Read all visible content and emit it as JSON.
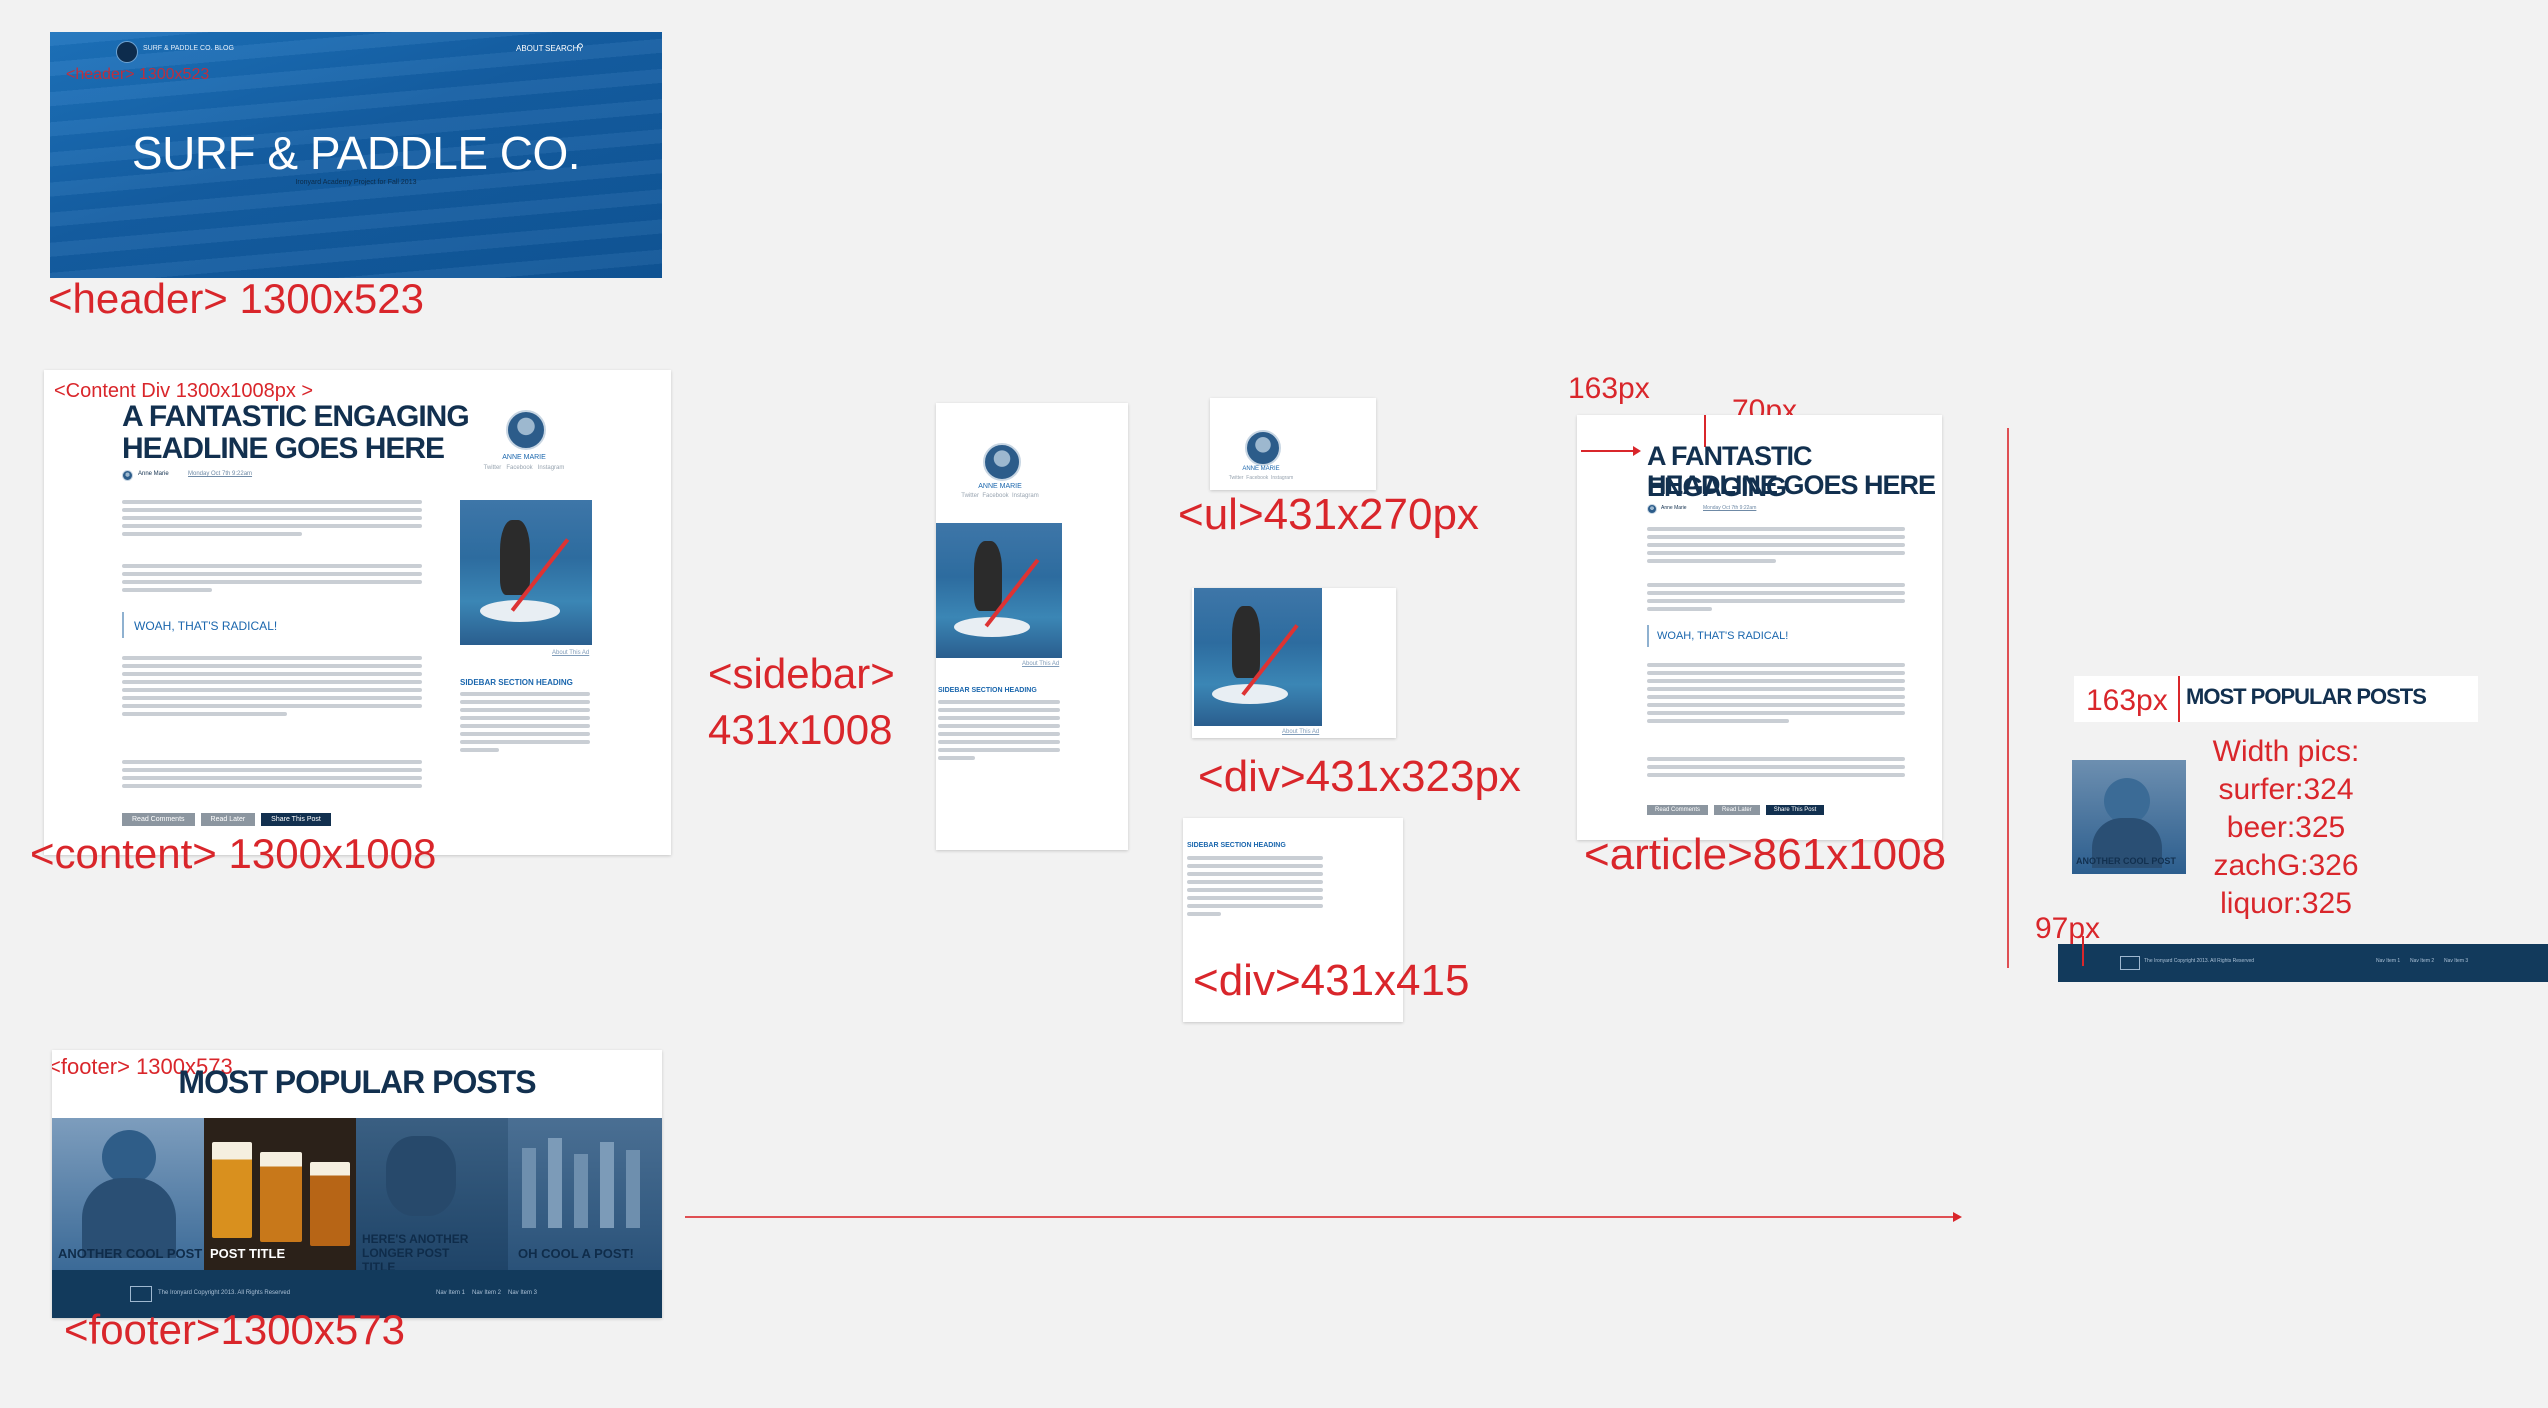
{
  "colors": {
    "annotation": "#d9262b",
    "navy": "#12304f",
    "blue": "#1a66ad",
    "footer": "#123a5c"
  },
  "header_mock": {
    "blog_name": "SURF & PADDLE CO. BLOG",
    "nav_about": "ABOUT",
    "nav_search": "SEARCH",
    "title": "SURF & PADDLE CO.",
    "subtitle": "Ironyard Academy Project for Fall 2013",
    "overlay_label": "<header> 1300x523",
    "caption": "<header> 1300x523"
  },
  "content_mock": {
    "label": "<Content Div 1300x1008px >",
    "headline_1": "A FANTASTIC ENGAGING",
    "headline_2": "HEADLINE GOES HERE",
    "author": "Anne Marie",
    "date": "Monday Oct 7th 9:22am",
    "pullquote": "WOAH, THAT'S RADICAL!",
    "sidebar_name": "ANNE MARIE",
    "social": [
      "Twitter",
      "Facebook",
      "Instagram"
    ],
    "photo_caption": "About This Ad",
    "sidebar_heading": "SIDEBAR SECTION HEADING",
    "buttons": [
      "Read Comments",
      "Read Later",
      "Share This Post"
    ],
    "caption": "<content> 1300x1008"
  },
  "sidebar_mock": {
    "name": "ANNE MARIE",
    "social": [
      "Twitter",
      "Facebook",
      "Instagram"
    ],
    "photo_caption": "About This Ad",
    "heading": "SIDEBAR SECTION HEADING",
    "caption_1": "<sidebar>",
    "caption_2": "431x1008"
  },
  "ul_mock": {
    "name": "ANNE MARIE",
    "social": [
      "Twitter",
      "Facebook",
      "Instagram"
    ],
    "caption": "<ul>431x270px"
  },
  "div_photo_mock": {
    "photo_caption": "About This Ad",
    "caption": "<div>431x323px"
  },
  "div_text_mock": {
    "heading": "SIDEBAR SECTION HEADING",
    "caption": "<div>431x415"
  },
  "article_mock": {
    "left_measure": "163px",
    "top_measure": "70px",
    "headline_1": "A FANTASTIC ENGAGING",
    "headline_2": "HEADLINE GOES HERE",
    "author": "Anne Marie",
    "date": "Monday Oct 7th 9:22am",
    "pullquote": "WOAH, THAT'S RADICAL!",
    "buttons": [
      "Read Comments",
      "Read Later",
      "Share This Post"
    ],
    "caption": "<article>861x1008"
  },
  "popular_mock": {
    "left_measure": "163px",
    "title": "MOST POPULAR POSTS",
    "thumb_label": "ANOTHER COOL POST",
    "width_notes": [
      "Width pics:",
      "surfer:324",
      "beer:325",
      "zachG:326",
      "liquor:325"
    ],
    "bottom_measure": "97px",
    "footer_copy": "The Ironyard Copyright 2013. All Rights Reserved",
    "footer_nav": [
      "Nav Item 1",
      "Nav Item 2",
      "Nav Item 3"
    ]
  },
  "footer_mock": {
    "label": "<footer>  1300x573",
    "title": "MOST POPULAR POSTS",
    "posts": [
      "ANOTHER COOL POST",
      "POST TITLE",
      "HERE'S ANOTHER LONGER POST TITLE",
      "OH COOL A POST!"
    ],
    "copy": "The Ironyard Copyright 2013. All Rights Reserved",
    "nav": [
      "Nav Item 1",
      "Nav Item 2",
      "Nav Item 3"
    ],
    "caption": "<footer>1300x573"
  }
}
